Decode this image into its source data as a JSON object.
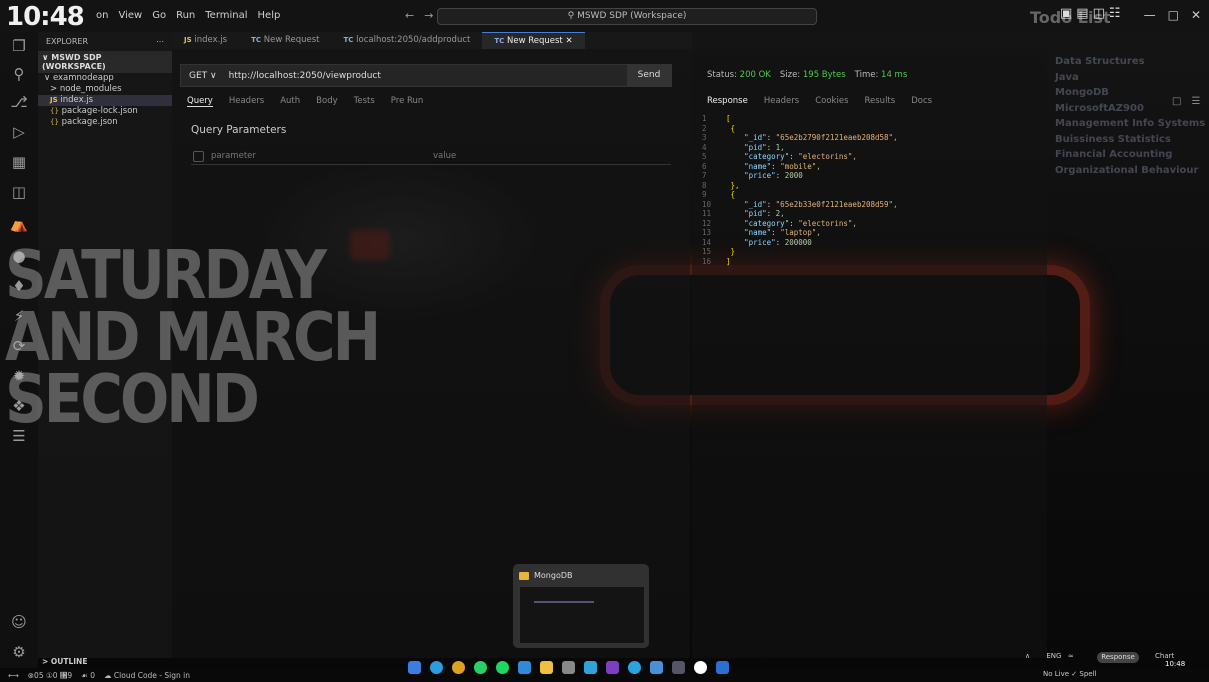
{
  "overlay": {
    "clock": "10:48"
  },
  "menu": [
    "on",
    "View",
    "Go",
    "Run",
    "Terminal",
    "Help"
  ],
  "titlebar": {
    "search": "MSWD SDP (Workspace)",
    "todo_title": "Todo List"
  },
  "explorer": {
    "header": "EXPLORER",
    "workspace": "MSWD SDP (WORKSPACE)",
    "items": [
      {
        "label": "examnodeapp",
        "prefix": "∨",
        "indent": 6
      },
      {
        "label": "node_modules",
        "prefix": ">",
        "indent": 12
      },
      {
        "label": "index.js",
        "prefix": "JS",
        "indent": 12
      },
      {
        "label": "package-lock.json",
        "prefix": "{}",
        "indent": 12
      },
      {
        "label": "package.json",
        "prefix": "{}",
        "indent": 12
      }
    ],
    "outline": "> OUTLINE"
  },
  "tabs": [
    {
      "icon": "JS",
      "label": "index.js"
    },
    {
      "icon": "TC",
      "label": "New Request"
    },
    {
      "icon": "TC",
      "label": "localhost:2050/addproduct"
    },
    {
      "icon": "TC",
      "label": "New Request"
    }
  ],
  "request": {
    "method": "GET",
    "url": "http://localhost:2050/viewproduct",
    "send": "Send",
    "tabs": [
      "Query",
      "Headers",
      "Auth",
      "Body",
      "Tests",
      "Pre Run"
    ],
    "query_title": "Query Parameters",
    "param_placeholder": "parameter",
    "value_placeholder": "value"
  },
  "date_text": [
    "SATURDAY",
    "AND MARCH",
    "SECOND"
  ],
  "response": {
    "status_label": "Status:",
    "status_value": "200 OK",
    "size_label": "Size:",
    "size_value": "195 Bytes",
    "time_label": "Time:",
    "time_value": "14 ms",
    "tabs": [
      "Response",
      "Headers",
      "Cookies",
      "Results",
      "Docs"
    ],
    "json_lines": [
      {
        "n": "1",
        "t": "["
      },
      {
        "n": "2",
        "t": "  {"
      },
      {
        "n": "3",
        "k": "\"_id\"",
        "v": "\"65e2b2790f2121eaeb208d58\"",
        "c": ","
      },
      {
        "n": "4",
        "k": "\"pid\"",
        "v": "1",
        "c": ","
      },
      {
        "n": "5",
        "k": "\"category\"",
        "v": "\"electorins\"",
        "c": ","
      },
      {
        "n": "6",
        "k": "\"name\"",
        "v": "\"mobile\"",
        "c": ","
      },
      {
        "n": "7",
        "k": "\"price\"",
        "v": "2000",
        "c": ""
      },
      {
        "n": "8",
        "t": "  },"
      },
      {
        "n": "9",
        "t": "  {"
      },
      {
        "n": "10",
        "k": "\"_id\"",
        "v": "\"65e2b33e0f2121eaeb208d59\"",
        "c": ","
      },
      {
        "n": "11",
        "k": "\"pid\"",
        "v": "2",
        "c": ","
      },
      {
        "n": "12",
        "k": "\"category\"",
        "v": "\"electorins\"",
        "c": ","
      },
      {
        "n": "13",
        "k": "\"name\"",
        "v": "\"laptop\"",
        "c": ","
      },
      {
        "n": "14",
        "k": "\"price\"",
        "v": "200000",
        "c": ""
      },
      {
        "n": "15",
        "t": "  }"
      },
      {
        "n": "16",
        "t": "]"
      }
    ]
  },
  "todo": [
    "Data Structures",
    "Java",
    "MongoDB",
    "MicrosoftAZ900",
    "Management Info Systems",
    "Buissiness Statistics",
    "Financial Accounting",
    "Organizational Behaviour"
  ],
  "preview": {
    "title": "MongoDB"
  },
  "statusbar": {
    "problems": "⊗05 ①0 ⑘9",
    "ports": "☙ 0",
    "cloud": "☁ Cloud Code - Sign in"
  },
  "tray": {
    "lang": "ENG",
    "response_btn": "Response",
    "chart": "Chart",
    "time": "10:48",
    "live": "No Live",
    "spell": "Spell"
  }
}
